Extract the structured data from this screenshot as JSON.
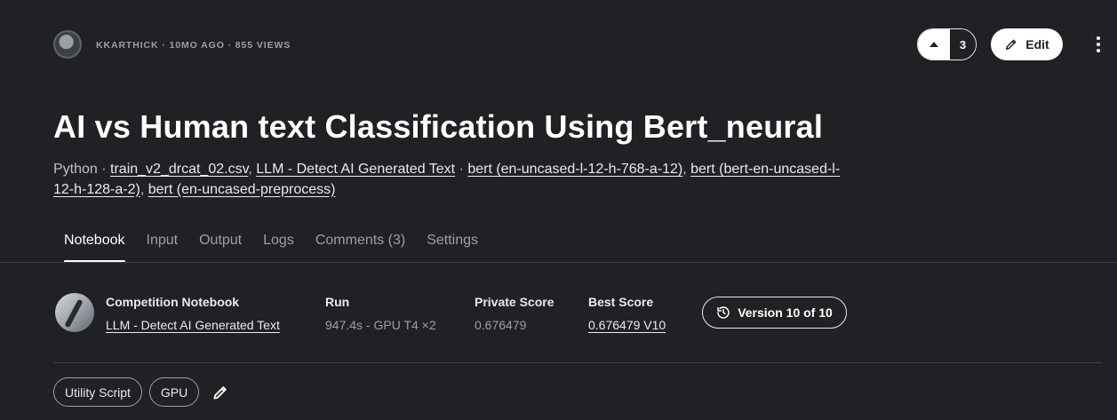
{
  "author": {
    "meta": "KKARTHICK · 10MO AGO · 855 VIEWS"
  },
  "actions": {
    "vote_count": "3",
    "edit_label": "Edit"
  },
  "notebook": {
    "title": "AI vs Human text Classification Using Bert_neural",
    "language": "Python",
    "sources": [
      "train_v2_drcat_02.csv",
      "LLM - Detect AI Generated Text",
      "bert (en-uncased-l-12-h-768-a-12)",
      "bert (bert-en-uncased-l-12-h-128-a-2)",
      "bert (en-uncased-preprocess)"
    ],
    "separators": {
      "dot": " · ",
      "comma": ", "
    }
  },
  "tabs": [
    {
      "label": "Notebook",
      "active": true
    },
    {
      "label": "Input"
    },
    {
      "label": "Output"
    },
    {
      "label": "Logs"
    },
    {
      "label": "Comments (3)"
    },
    {
      "label": "Settings"
    }
  ],
  "details": {
    "competition": {
      "label": "Competition Notebook",
      "value": "LLM - Detect AI Generated Text"
    },
    "run": {
      "label": "Run",
      "value": "947.4s - GPU T4 ×2"
    },
    "private_score": {
      "label": "Private Score",
      "value": "0.676479"
    },
    "best_score": {
      "label": "Best Score",
      "value": "0.676479 V10"
    },
    "version_label": "Version 10 of 10"
  },
  "tags": [
    "Utility Script",
    "GPU"
  ],
  "icons": {
    "edit": "pencil-icon",
    "version": "history-icon",
    "more": "kebab-icon",
    "tag_edit": "pencil-icon"
  }
}
